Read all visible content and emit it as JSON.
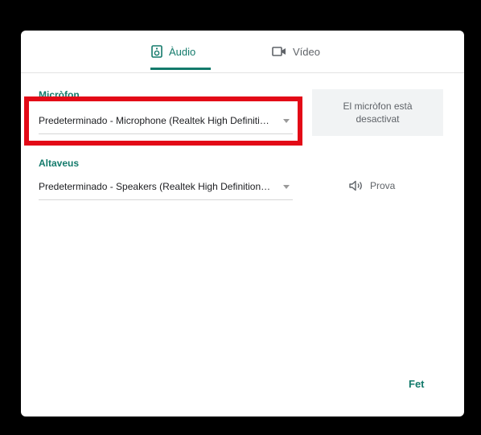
{
  "tabs": {
    "audio_label": "Àudio",
    "video_label": "Vídeo",
    "active": "audio"
  },
  "microphone": {
    "label": "Micròfon",
    "selected": "Predeterminado - Microphone (Realtek High Definition Audio)",
    "status": "El micròfon està desactivat"
  },
  "speakers": {
    "label": "Altaveus",
    "selected": "Predeterminado - Speakers (Realtek High Definition Audio)",
    "test_label": "Prova"
  },
  "footer": {
    "done_label": "Fet"
  },
  "colors": {
    "accent": "#137a6b",
    "highlight": "#e30a17",
    "status_bg": "#f1f3f4"
  },
  "icons": {
    "audio_tab": "speaker-icon",
    "video_tab": "video-camera-icon",
    "test": "volume-icon",
    "dropdown": "caret-down-icon"
  }
}
